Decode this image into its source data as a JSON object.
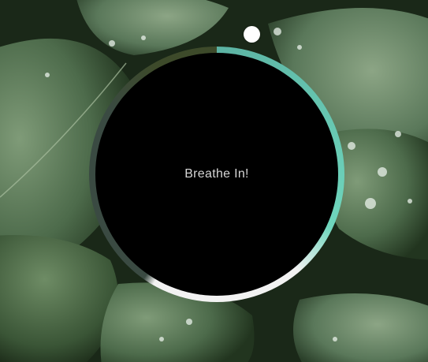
{
  "app": {
    "instruction_text": "Breathe In!"
  },
  "progress": {
    "fraction": 0.14
  },
  "colors": {
    "ring_dark": "#3d4a2a",
    "ring_mid": "#5cb3a3",
    "ring_teal": "#6fd6bd",
    "ring_white": "#f2f2f2",
    "ring_grey": "#3a4a42",
    "center": "#000000",
    "text": "#d6d6d6",
    "pointer": "#ffffff"
  },
  "icons": {
    "background": "leaves-photo",
    "pointer": "pointer-dot-icon"
  }
}
